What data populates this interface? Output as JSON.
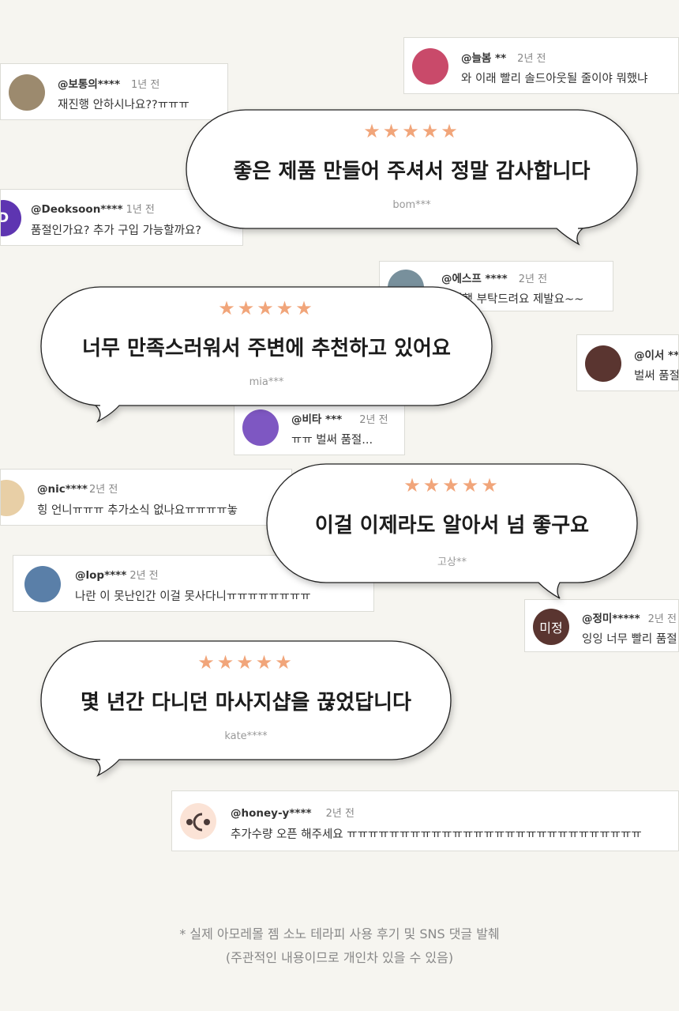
{
  "comments": [
    {
      "user": "@보통의****",
      "time": "1년 전",
      "text": "재진행 안하시나요??ㅠㅠㅠ",
      "avatar_color": "#9c8a6e",
      "avatar_text": ""
    },
    {
      "user": "@늘봄 **",
      "time": "2년 전",
      "text": "와 이래 빨리 솔드아웃될 줄이야 뭐했냐",
      "avatar_color": "#c94a6a",
      "avatar_text": ""
    },
    {
      "user": "@Deoksoon****",
      "time": "1년 전",
      "text": "품절인가요? 추가 구입 가능할까요?",
      "avatar_color": "#5e35b1",
      "avatar_text": "D"
    },
    {
      "user": "@에스프 ****",
      "time": "2년 전",
      "text": "재진행 부탁드려요  제발요~~",
      "avatar_color": "#78909c",
      "avatar_text": ""
    },
    {
      "user": "@이서 **",
      "time": "",
      "text": "벌써 품절",
      "avatar_color": "#5a3530",
      "avatar_text": ""
    },
    {
      "user": "@비타 ***",
      "time": "2년 전",
      "text": "ㅠㅠ 벌써 품절...",
      "avatar_color": "#7e57c2",
      "avatar_text": ""
    },
    {
      "user": "@nic****",
      "time": "2년 전",
      "text": "힝 언니ㅠㅠㅠ 추가소식 없나요ㅠㅠㅠㅠ놓",
      "avatar_color": "#e8cfa6",
      "avatar_text": ""
    },
    {
      "user": "@lop****",
      "time": "2년 전",
      "text": "나란 이 못난인간 이걸 못사다니ㅠㅠㅠㅠㅠㅠㅠㅠ",
      "avatar_color": "#5a7fa8",
      "avatar_text": ""
    },
    {
      "user": "@정미*****",
      "time": "2년 전",
      "text": "잉잉 너무 빨리 품절",
      "avatar_color": "#5a3530",
      "avatar_text": "미정"
    },
    {
      "user": "@honey-y****",
      "time": "2년 전",
      "text": "추가수량 오픈 해주세요 ㅠㅠㅠㅠㅠㅠㅠㅠㅠㅠㅠㅠㅠㅠㅠㅠㅠㅠㅠㅠㅠㅠㅠㅠㅠㅠㅠㅠ",
      "avatar_color": "#fbe3d6",
      "avatar_text": ""
    }
  ],
  "reviews": [
    {
      "stars": "★★★★★",
      "rating": 5,
      "text": "좋은 제품 만들어 주셔서 정말 감사합니다",
      "author": "bom***"
    },
    {
      "stars": "★★★★★",
      "rating": 5,
      "text": "너무 만족스러워서 주변에 추천하고 있어요",
      "author": "mia***"
    },
    {
      "stars": "★★★★★",
      "rating": 5,
      "text": "이걸 이제라도 알아서 넘 좋구요",
      "author": "고상**"
    },
    {
      "stars": "★★★★★",
      "rating": 5,
      "text": "몇 년간 다니던 마사지샵을 끊었답니다",
      "author": "kate****"
    }
  ],
  "footnote": {
    "line1": "* 실제 아모레몰 젬 소노 테라피 사용 후기 및 SNS 댓글 발췌",
    "line2": "(주관적인 내용이므로 개인차 있을 수 있음)"
  },
  "colors": {
    "background": "#f6f5f0",
    "star": "#f1a57a",
    "bubble_fill": "#ffffff",
    "bubble_stroke": "#222222"
  }
}
